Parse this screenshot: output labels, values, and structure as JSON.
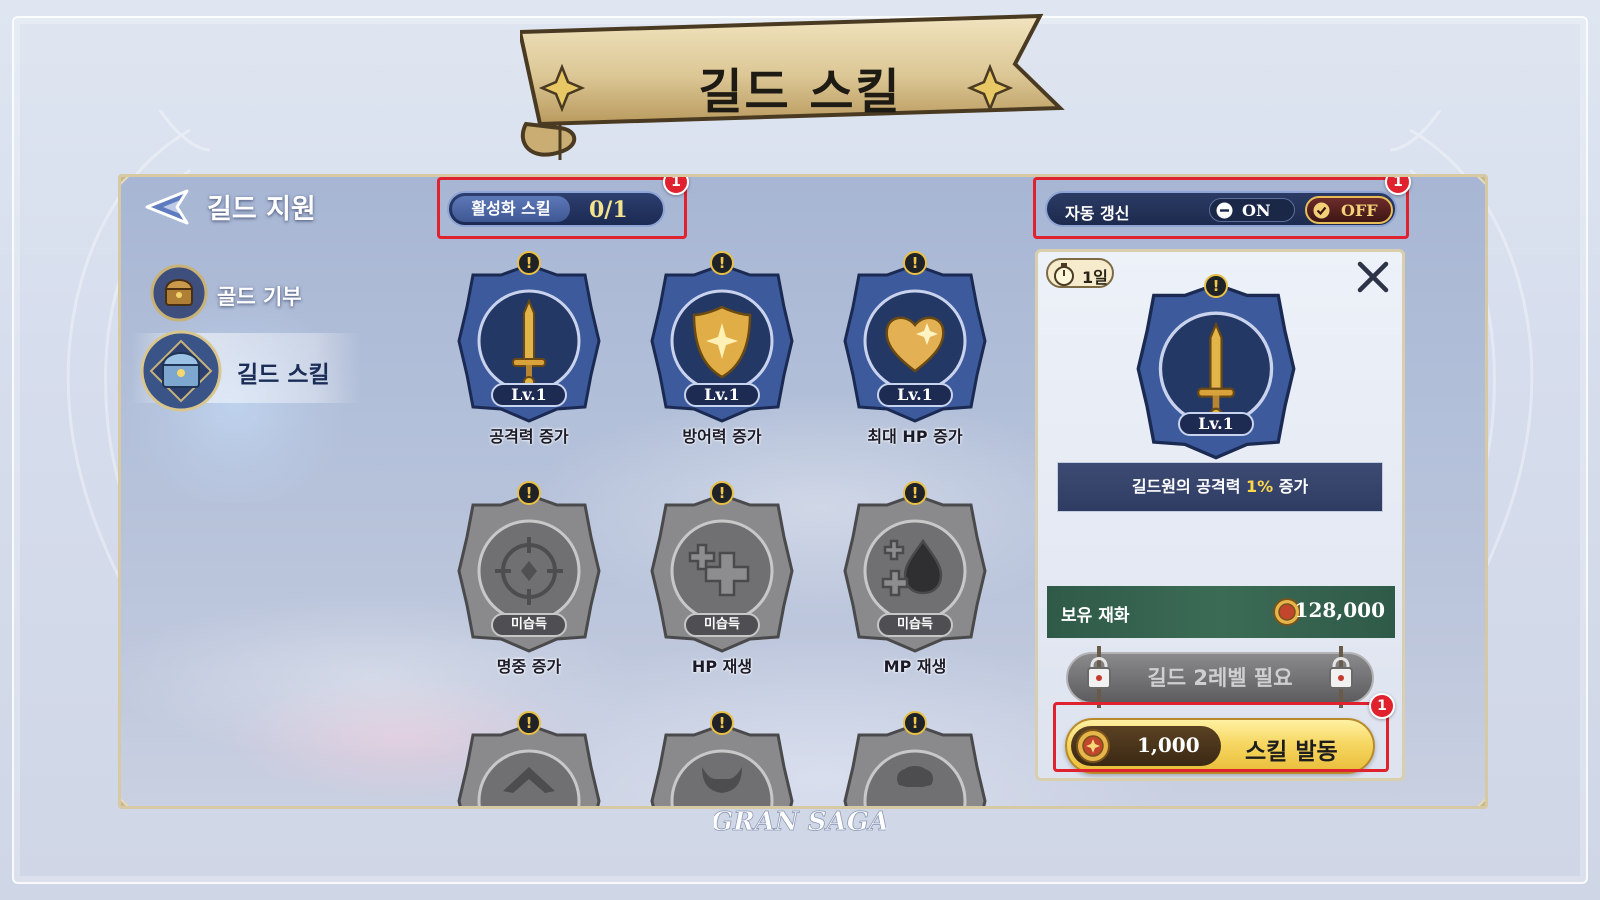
{
  "title": "길드 스킬",
  "nav": {
    "header": "길드 지원",
    "items": [
      {
        "label": "골드 기부"
      },
      {
        "label": "길드 스킬"
      }
    ]
  },
  "active_skills": {
    "label": "활성화 스킬",
    "value": "0/1"
  },
  "auto_renew": {
    "label": "자동 갱신",
    "on": "ON",
    "off": "OFF",
    "state": "OFF"
  },
  "skills": [
    {
      "name": "공격력 증가",
      "level": "Lv.1",
      "icon": "sword-icon"
    },
    {
      "name": "방어력 증가",
      "level": "Lv.1",
      "icon": "shield-icon"
    },
    {
      "name": "최대 HP 증가",
      "level": "Lv.1",
      "icon": "heart-icon"
    },
    {
      "name": "명중 증가",
      "level": "미습득",
      "icon": "crosshair-icon"
    },
    {
      "name": "HP 재생",
      "level": "미습득",
      "icon": "hp-regen-icon"
    },
    {
      "name": "MP 재생",
      "level": "미습득",
      "icon": "mp-regen-icon"
    }
  ],
  "detail": {
    "duration": "1일",
    "level": "Lv.1",
    "desc_prefix": "길드원의 공격력 ",
    "desc_highlight": "1%",
    "desc_suffix": " 증가",
    "currency_label": "보유 재화",
    "currency_value": "128,000",
    "requirement": "길드 2레벨 필요",
    "cost": "1,000",
    "activate_label": "스킬 발동"
  },
  "badges": [
    "1",
    "1",
    "1"
  ],
  "logo": "GRAN SAGA",
  "colors": {
    "highlight_red": "#e0212e",
    "gold": "#f6d762",
    "accent_yellow": "#ffd84a"
  }
}
